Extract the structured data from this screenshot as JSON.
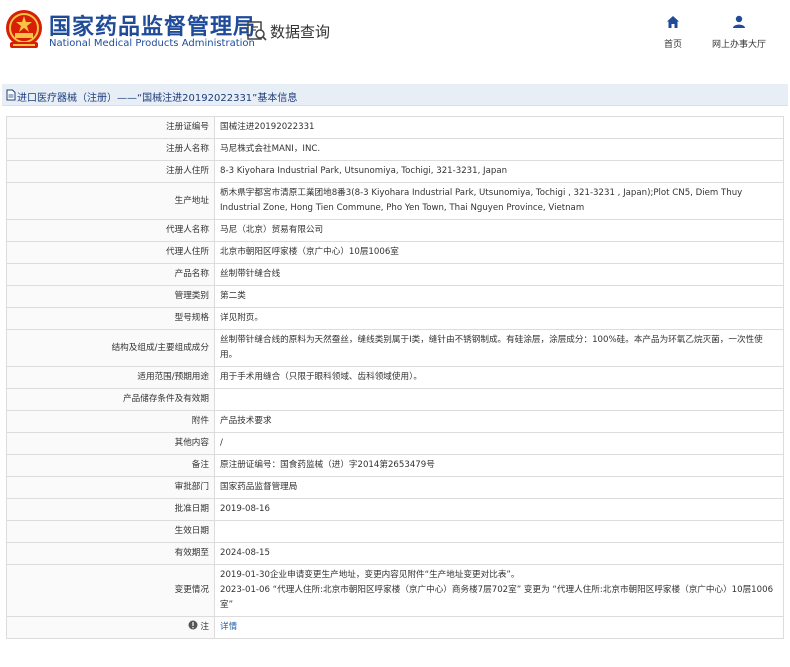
{
  "header": {
    "brand_cn": "国家药品监督管理局",
    "brand_en": "National Medical Products Administration",
    "page_heading": "数据查询",
    "nav": [
      {
        "label": "首页",
        "icon": "home-icon"
      },
      {
        "label": "网上办事大厅",
        "icon": "user-icon"
      }
    ]
  },
  "title_bar": {
    "text": "进口医疗器械（注册）——“国械注进20192022331”基本信息"
  },
  "rows": {
    "reg_no": {
      "label": "注册证编号",
      "value": "国械注进20192022331"
    },
    "registrant": {
      "label": "注册人名称",
      "value": "马尼株式会社MANI，INC."
    },
    "registrant_addr": {
      "label": "注册人住所",
      "value": "8-3 Kiyohara Industrial Park, Utsunomiya, Tochigi, 321-3231, Japan"
    },
    "production_addr": {
      "label": "生产地址",
      "value": "栃木県宇都宮市清原工業团地8番3(8-3 Kiyohara Industrial Park, Utsunomiya, Tochigi , 321-3231 , Japan);Plot CN5, Diem Thuy Industrial Zone, Hong Tien Commune, Pho Yen Town, Thai Nguyen Province, Vietnam"
    },
    "agent": {
      "label": "代理人名称",
      "value": "马尼（北京）贸易有限公司"
    },
    "agent_addr": {
      "label": "代理人住所",
      "value": "北京市朝阳区呼家楼（京广中心）10层1006室"
    },
    "product_name": {
      "label": "产品名称",
      "value": "丝制带针缝合线"
    },
    "category": {
      "label": "管理类别",
      "value": "第二类"
    },
    "model": {
      "label": "型号规格",
      "value": "详见附页。"
    },
    "composition": {
      "label": "结构及组成/主要组成成分",
      "value": "丝制带针缝合线的原料为天然蚕丝，缝线类别属于Ⅰ类，缝针由不锈钢制成。有硅涂层，涂层成分：100%硅。本产品为环氧乙烷灭菌，一次性使用。"
    },
    "scope": {
      "label": "适用范围/预期用途",
      "value": "用于手术用缝合（只限于眼科领域、齿科领域使用）。"
    },
    "storage": {
      "label": "产品储存条件及有效期",
      "value": ""
    },
    "attachment": {
      "label": "附件",
      "value": "产品技术要求"
    },
    "other": {
      "label": "其他内容",
      "value": "/"
    },
    "remark": {
      "label": "备注",
      "value": "原注册证编号：国食药监械（进）字2014第2653479号"
    },
    "approval_dept": {
      "label": "审批部门",
      "value": "国家药品监督管理局"
    },
    "approval_date": {
      "label": "批准日期",
      "value": "2019-08-16"
    },
    "effective_date": {
      "label": "生效日期",
      "value": ""
    },
    "expiry_date": {
      "label": "有效期至",
      "value": "2024-08-15"
    },
    "changes": {
      "label": "变更情况",
      "lines": [
        "2019-01-30企业申请变更生产地址，变更内容见附件“生产地址变更对比表”。",
        "2023-01-06 “代理人住所:北京市朝阳区呼家楼（京广中心）商务楼7层702室” 变更为 “代理人住所:北京市朝阳区呼家楼（京广中心）10层1006室”"
      ]
    },
    "note": {
      "label": "注",
      "value": "详情"
    }
  },
  "colors": {
    "brand": "#1f4b99",
    "title_bar_bg": "#e8eef6",
    "link": "#1f5fa8",
    "border": "#dcdcdc"
  }
}
